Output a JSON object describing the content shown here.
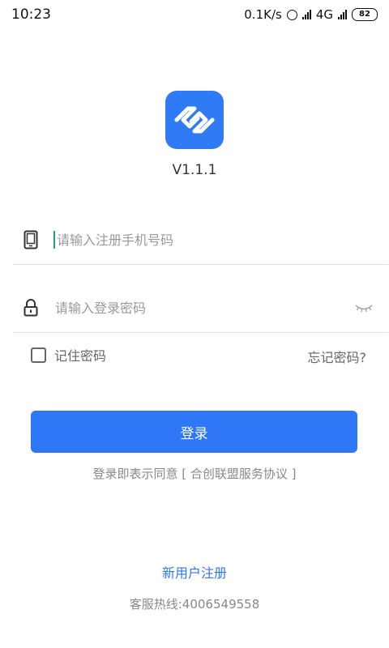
{
  "status_bar": {
    "time": "10:23",
    "speed": "0.1K/s",
    "network": "4G",
    "battery": "82"
  },
  "app": {
    "version": "V1.1.1",
    "accent_color": "#2e77f7"
  },
  "form": {
    "phone_placeholder": "请输入注册手机号码",
    "password_placeholder": "请输入登录密码",
    "remember_label": "记住密码",
    "forgot_label": "忘记密码?",
    "login_label": "登录"
  },
  "footer": {
    "agreement": "登录即表示同意 [ 合创联盟服务协议 ]",
    "register": "新用户注册",
    "hotline": "客服热线:4006549558"
  },
  "icons": [
    "phone-icon",
    "lock-icon",
    "eye-closed-icon",
    "alarm-icon",
    "signal-icon",
    "battery-icon"
  ]
}
